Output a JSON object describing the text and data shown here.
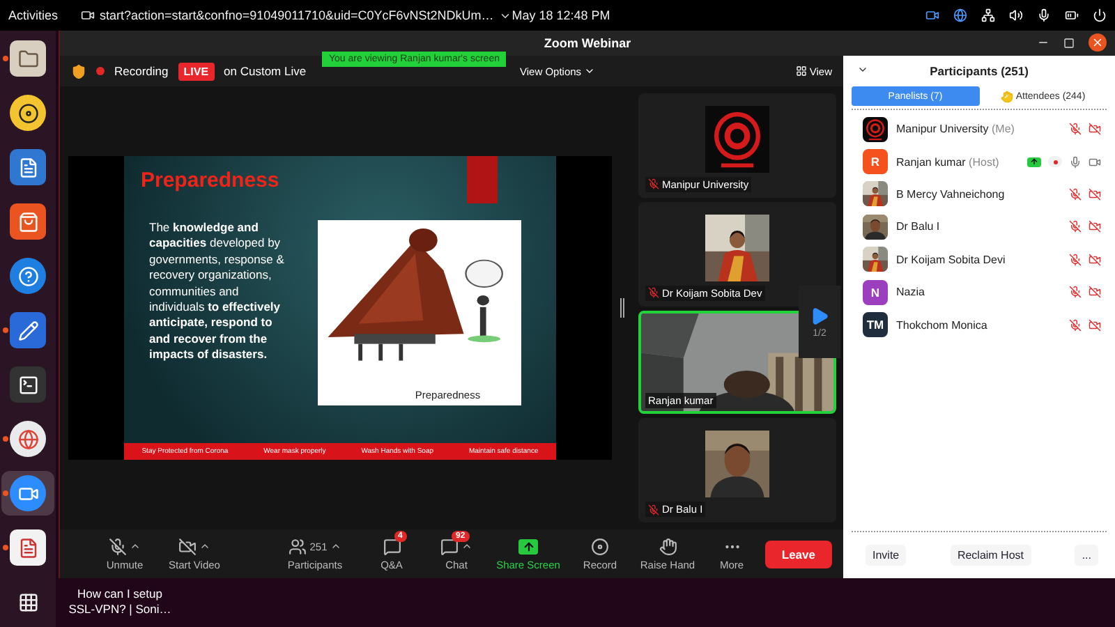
{
  "top_bar": {
    "activities": "Activities",
    "app_title": "start?action=start&confno=91049011710&uid=C0YcF6vNSt2NDkUm…",
    "clock": "May 18  12:48 PM"
  },
  "dock": [
    {
      "running": true,
      "selected": false
    },
    {
      "running": false,
      "selected": false
    },
    {
      "running": false,
      "selected": false
    },
    {
      "running": false,
      "selected": false
    },
    {
      "running": false,
      "selected": false
    },
    {
      "running": true,
      "selected": false
    },
    {
      "running": false,
      "selected": false
    },
    {
      "running": true,
      "selected": false
    },
    {
      "running": true,
      "selected": true
    },
    {
      "running": true,
      "selected": false
    },
    {
      "running": false,
      "selected": false
    }
  ],
  "window": {
    "title": "Zoom Webinar"
  },
  "meeting_bar": {
    "recording": "Recording",
    "live": "LIVE",
    "stream": "on Custom Live",
    "banner": "You are viewing Ranjan kumar's screen",
    "view_options": "View Options",
    "view": "View"
  },
  "slide": {
    "title": "Preparedness",
    "body": "The **knowledge and capacities** developed by governments, response & recovery organizations, communities and individuals **to effectively anticipate, respond to and recover from the impacts of disasters.**",
    "picture_caption": "Preparedness",
    "footer": [
      "Stay Protected from Corona",
      "Wear mask properly",
      "Wash Hands with Soap",
      "Maintain safe distance"
    ]
  },
  "videos": {
    "tiles": [
      {
        "name": "Manipur University",
        "mic_muted": true,
        "active": false
      },
      {
        "name": "Dr Koijam Sobita Dev",
        "mic_muted": true,
        "active": false
      },
      {
        "name": "Ranjan kumar",
        "kind": "video",
        "mic_muted": false,
        "active": true
      },
      {
        "name": "Dr Balu I",
        "mic_muted": true,
        "active": false
      }
    ],
    "page": "1/2"
  },
  "toolbar": [
    {
      "label": "Unmute",
      "kind": "mic",
      "menu": true
    },
    {
      "label": "Start Video",
      "kind": "video",
      "menu": true
    },
    {
      "label": "Participants",
      "kind": "participants",
      "count": "251",
      "menu": true
    },
    {
      "label": "Q&A",
      "kind": "qa",
      "badge": "4",
      "menu": false
    },
    {
      "label": "Chat",
      "kind": "chat",
      "badge": "92",
      "menu": true
    },
    {
      "label": "Share Screen",
      "kind": "share",
      "menu": false
    },
    {
      "label": "Record",
      "kind": "record",
      "menu": false
    },
    {
      "label": "Raise Hand",
      "kind": "hand",
      "menu": false
    },
    {
      "label": "More",
      "kind": "more",
      "menu": false
    }
  ],
  "leave": "Leave",
  "participants": {
    "title": "Participants (251)",
    "tabs": [
      {
        "label": "Panelists (7)",
        "selected": true
      },
      {
        "label": "Attendees (244)",
        "selected": false
      }
    ],
    "list": [
      {
        "name": "Manipur University",
        "role": "(Me)",
        "mic_muted": true,
        "video_off": true,
        "sharing": false,
        "recording": false
      },
      {
        "name": "Ranjan kumar",
        "role": "(Host)",
        "avatar": {
          "kind": "letter",
          "text": "R",
          "color": "#f4511e"
        },
        "mic_muted": false,
        "video_off": false,
        "sharing": true,
        "recording": true
      },
      {
        "name": "B Mercy Vahneichong",
        "mic_muted": true,
        "video_off": true,
        "sharing": false,
        "recording": false
      },
      {
        "name": "Dr Balu I",
        "mic_muted": true,
        "video_off": true,
        "sharing": false,
        "recording": false
      },
      {
        "name": "Dr Koijam Sobita Devi",
        "mic_muted": true,
        "video_off": true,
        "sharing": false,
        "recording": false
      },
      {
        "name": "Nazia",
        "avatar": {
          "kind": "letter",
          "text": "N",
          "color": "#9c3fbf"
        },
        "mic_muted": true,
        "video_off": true,
        "sharing": false,
        "recording": false
      },
      {
        "name": "Thokchom Monica",
        "avatar": {
          "kind": "letter",
          "text": "TM",
          "color": "#1f2d3d"
        },
        "mic_muted": true,
        "video_off": true,
        "sharing": false,
        "recording": false
      }
    ],
    "buttons": [
      "Invite",
      "Reclaim Host",
      "..."
    ]
  },
  "desktop_file": "How can I setup SSL-VPN? | Soni…"
}
